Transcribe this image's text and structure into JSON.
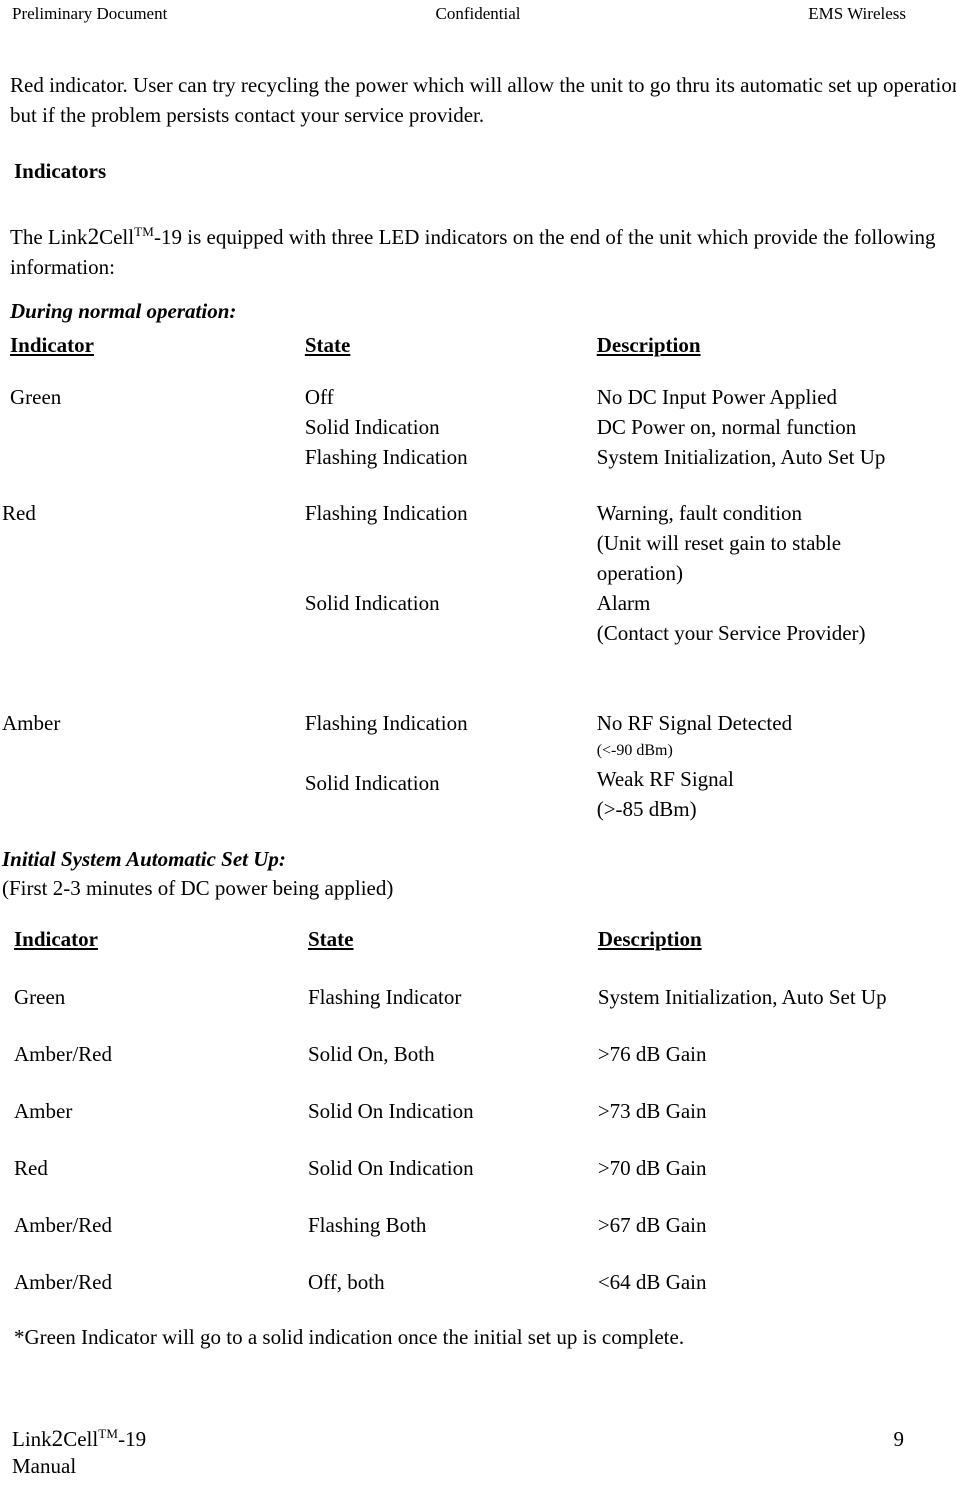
{
  "header": {
    "left": "Preliminary Document",
    "center": "Confidential",
    "right": "EMS Wireless"
  },
  "intro_paragraph": "Red indicator.  User can try recycling the power which will allow the unit to go thru its automatic set up operation but if the problem persists contact your service provider.",
  "indicators_heading": "Indicators",
  "equipped_paragraph_pre": "The Link",
  "equipped_paragraph_two": "2",
  "equipped_paragraph_cell": "Cell",
  "equipped_paragraph_tm": "TM",
  "equipped_paragraph_post": "-19  is equipped with three LED indicators on the end of the unit which provide the following information:",
  "section1": {
    "title": "During normal operation:",
    "columns": [
      "Indicator",
      "State",
      "Description"
    ],
    "rows": [
      {
        "indicator": "Green",
        "lines": [
          {
            "state": "Off",
            "description": "No DC Input Power Applied"
          },
          {
            "state": "Solid Indication",
            "description": "DC Power on, normal function"
          },
          {
            "state": "Flashing Indication",
            "description": "System Initialization, Auto Set Up"
          }
        ]
      },
      {
        "indicator": "Red",
        "lines": [
          {
            "state": "Flashing Indication",
            "description": "Warning, fault condition"
          },
          {
            "state": "",
            "description": "(Unit will reset gain to stable"
          },
          {
            "state": "",
            "description": "operation)"
          },
          {
            "state": "Solid Indication",
            "description": "Alarm"
          },
          {
            "state": "",
            "description": "(Contact your Service Provider)"
          }
        ]
      },
      {
        "indicator": "Amber",
        "lines": [
          {
            "state": "Flashing Indication",
            "description": "No RF Signal Detected"
          },
          {
            "state": "",
            "description": "(<-90 dBm)",
            "small": true
          },
          {
            "state": "Solid Indication",
            "description": "Weak RF Signal"
          },
          {
            "state": "",
            "description": "(>-85 dBm)"
          }
        ]
      }
    ]
  },
  "section2": {
    "title": "Initial System Automatic Set Up:",
    "subtitle": "(First 2-3 minutes of DC power being applied)",
    "columns": [
      "Indicator",
      "State",
      "Description"
    ],
    "rows": [
      {
        "indicator": "Green",
        "state": "Flashing Indicator",
        "description": "System Initialization, Auto Set Up"
      },
      {
        "indicator": "Amber/Red",
        "state": "Solid On, Both",
        "description": ">76 dB Gain"
      },
      {
        "indicator": "Amber",
        "state": "Solid On Indication",
        "description": ">73 dB Gain"
      },
      {
        "indicator": "Red",
        "state": "Solid On Indication",
        "description": ">70 dB Gain"
      },
      {
        "indicator": "Amber/Red",
        "state": "Flashing Both",
        "description": ">67 dB Gain"
      },
      {
        "indicator": "Amber/Red",
        "state": "Off, both",
        "description": "<64 dB Gain"
      }
    ]
  },
  "footnote": "*Green Indicator will go to a solid indication once the initial set up is complete.",
  "footer": {
    "product_pre": "Link",
    "product_two": "2",
    "product_cell": "Cell",
    "product_tm": "TM",
    "product_post": "-19",
    "manual": "Manual",
    "page_number": "9"
  }
}
